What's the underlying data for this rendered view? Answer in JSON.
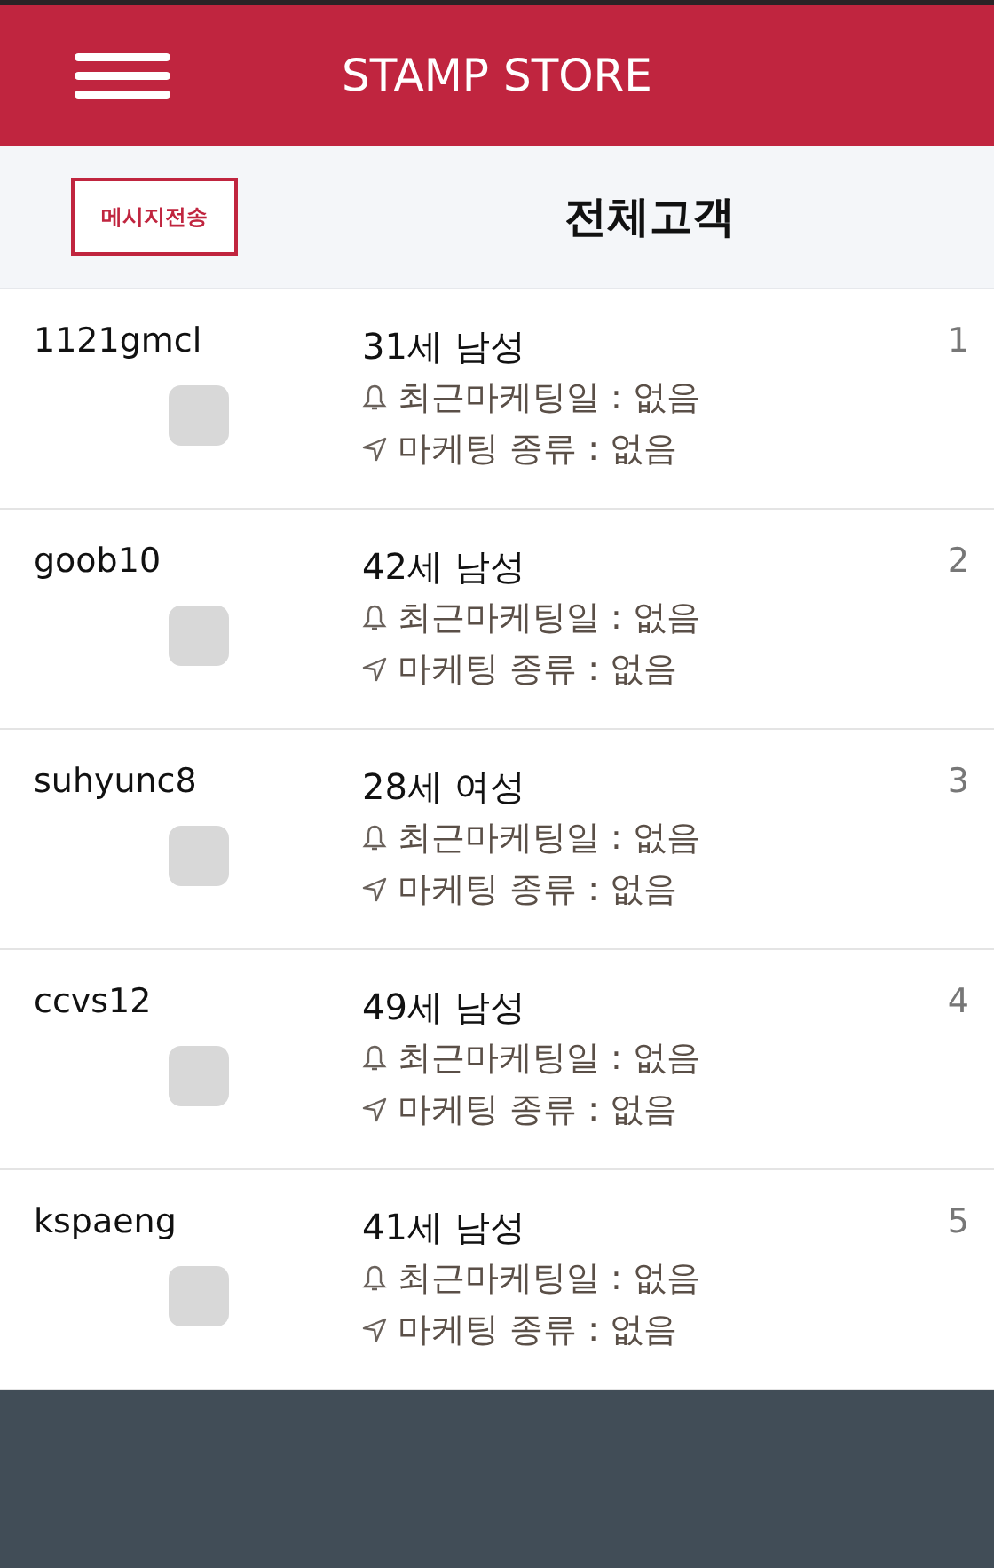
{
  "header": {
    "title": "STAMP STORE"
  },
  "toolbar": {
    "send_button": "메시지전송",
    "title": "전체고객"
  },
  "customers": [
    {
      "id": "1121gmcl",
      "checked": false,
      "profile": "31세 남성",
      "last_marketing": "최근마케팅일 : 없음",
      "marketing_type": "마케팅 종류 : 없음",
      "number": "1"
    },
    {
      "id": "goob10",
      "checked": false,
      "profile": "42세 남성",
      "last_marketing": "최근마케팅일 : 없음",
      "marketing_type": "마케팅 종류 : 없음",
      "number": "2"
    },
    {
      "id": "suhyunc8",
      "checked": false,
      "profile": "28세 여성",
      "last_marketing": "최근마케팅일 : 없음",
      "marketing_type": "마케팅 종류 : 없음",
      "number": "3"
    },
    {
      "id": "ccvs12",
      "checked": false,
      "profile": "49세 남성",
      "last_marketing": "최근마케팅일 : 없음",
      "marketing_type": "마케팅 종류 : 없음",
      "number": "4"
    },
    {
      "id": "kspaeng",
      "checked": false,
      "profile": "41세 남성",
      "last_marketing": "최근마케팅일 : 없음",
      "marketing_type": "마케팅 종류 : 없음",
      "number": "5"
    }
  ]
}
